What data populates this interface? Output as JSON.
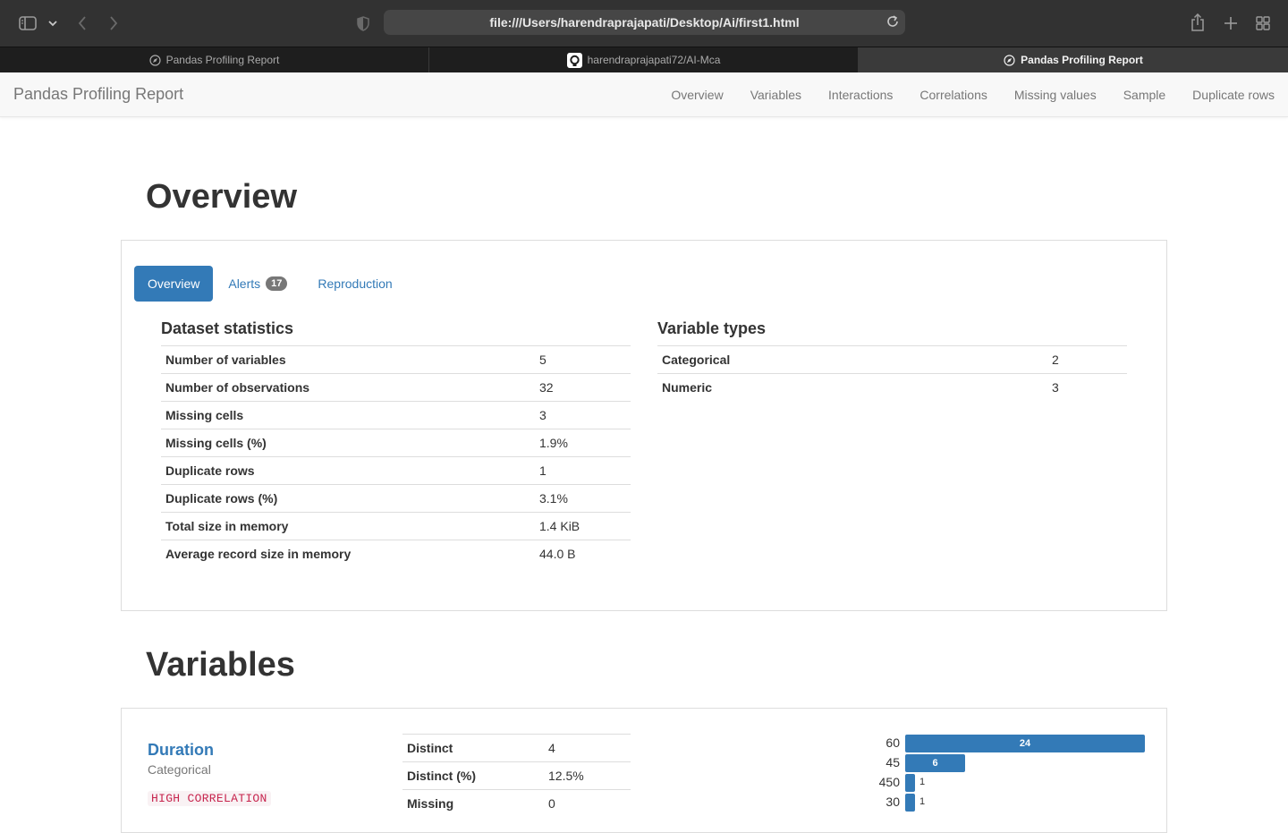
{
  "browser": {
    "url": "file:///Users/harendraprajapati/Desktop/Ai/first1.html",
    "tabs": [
      {
        "label": "Pandas Profiling Report",
        "icon": "compass-icon",
        "active": false
      },
      {
        "label": "harendraprajapati72/AI-Mca",
        "icon": "github-icon",
        "active": false
      },
      {
        "label": "Pandas Profiling Report",
        "icon": "compass-icon",
        "active": true
      }
    ]
  },
  "navbar": {
    "brand": "Pandas Profiling Report",
    "links": [
      "Overview",
      "Variables",
      "Interactions",
      "Correlations",
      "Missing values",
      "Sample",
      "Duplicate rows"
    ]
  },
  "overview": {
    "heading": "Overview",
    "tabs": {
      "overview": "Overview",
      "alerts": "Alerts",
      "alerts_count": "17",
      "reproduction": "Reproduction"
    },
    "dataset_stats_title": "Dataset statistics",
    "dataset_stats": [
      {
        "label": "Number of variables",
        "value": "5"
      },
      {
        "label": "Number of observations",
        "value": "32"
      },
      {
        "label": "Missing cells",
        "value": "3"
      },
      {
        "label": "Missing cells (%)",
        "value": "1.9%"
      },
      {
        "label": "Duplicate rows",
        "value": "1"
      },
      {
        "label": "Duplicate rows (%)",
        "value": "3.1%"
      },
      {
        "label": "Total size in memory",
        "value": "1.4 KiB"
      },
      {
        "label": "Average record size in memory",
        "value": "44.0 B"
      }
    ],
    "variable_types_title": "Variable types",
    "variable_types": [
      {
        "label": "Categorical",
        "value": "2"
      },
      {
        "label": "Numeric",
        "value": "3"
      }
    ]
  },
  "variables": {
    "heading": "Variables",
    "duration": {
      "name": "Duration",
      "type": "Categorical",
      "tag": "HIGH CORRELATION",
      "stats": [
        {
          "label": "Distinct",
          "value": "4"
        },
        {
          "label": "Distinct (%)",
          "value": "12.5%"
        },
        {
          "label": "Missing",
          "value": "0"
        }
      ],
      "frequencies": [
        {
          "label": "60",
          "count": 24
        },
        {
          "label": "45",
          "count": 6
        },
        {
          "label": "450",
          "count": 1
        },
        {
          "label": "30",
          "count": 1
        }
      ]
    }
  },
  "colors": {
    "primary": "#337ab7",
    "tag_text": "#c7254e",
    "tag_bg": "#f9f2f4"
  }
}
